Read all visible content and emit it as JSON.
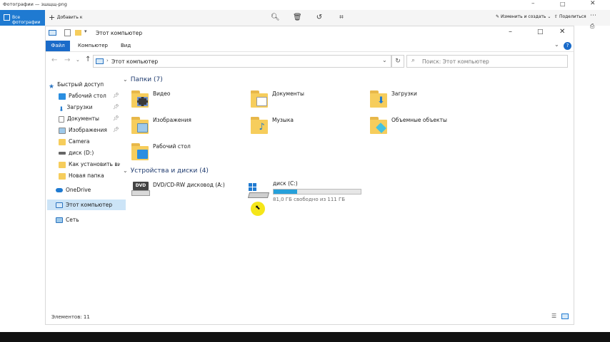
{
  "photos": {
    "title": "Фотографии — зшщщ-png",
    "all_photos": "Все фотографии",
    "add_to": "Добавить к",
    "edit_create": "Изменить и создать",
    "share": "Поделиться"
  },
  "explorer": {
    "title": "Этот компьютер",
    "tabs": [
      "Файл",
      "Компьютер",
      "Вид"
    ],
    "address": "Этот компьютер",
    "search_placeholder": "Поиск: Этот компьютер",
    "nav": {
      "quick_access": "Быстрый доступ",
      "items": [
        "Рабочий стол",
        "Загрузки",
        "Документы",
        "Изображения",
        "Camera",
        "диск (D:)",
        "Как установить ви",
        "Новая папка"
      ],
      "onedrive": "OneDrive",
      "this_pc": "Этот компьютер",
      "network": "Сеть"
    },
    "folders_header": "Папки (7)",
    "folders": [
      "Видео",
      "Документы",
      "Загрузки",
      "Изображения",
      "Музыка",
      "Объемные объекты",
      "Рабочий стол"
    ],
    "devices_header": "Устройства и диски (4)",
    "dvd_label": "DVD/CD-RW дисковод (A:)",
    "disk": {
      "label": "диск (C:)",
      "free": "81,0 ГБ свободно из 111 ГБ",
      "used_fraction": 0.27
    },
    "status": "Элементов: 11"
  },
  "colors": {
    "accent": "#1a6bc9",
    "folder": "#f6cd5c",
    "cursor_highlight": "#f4e300"
  }
}
